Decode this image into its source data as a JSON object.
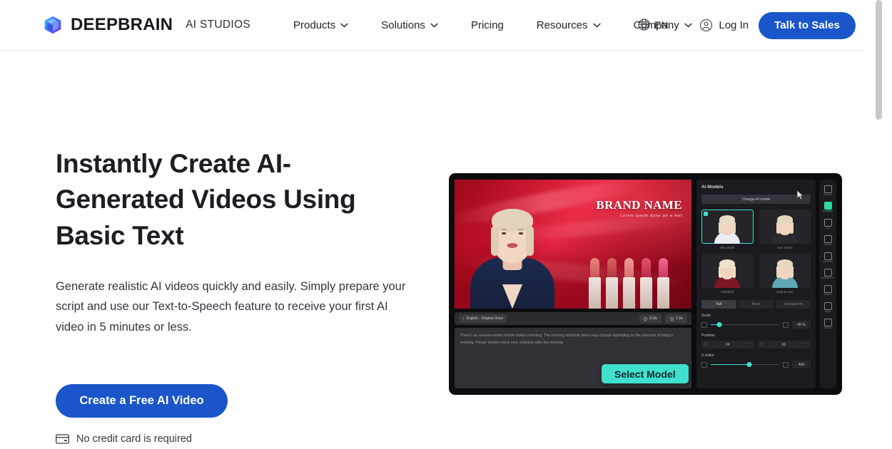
{
  "header": {
    "brand_name": "DEEPBRAIN",
    "brand_sub": "AI STUDIOS",
    "logo_icon": "cube-logo-icon",
    "nav": [
      {
        "label": "Products",
        "has_chevron": true,
        "icon": "chevron-down-icon"
      },
      {
        "label": "Solutions",
        "has_chevron": true,
        "icon": "chevron-down-icon"
      },
      {
        "label": "Pricing",
        "has_chevron": false,
        "icon": ""
      },
      {
        "label": "Resources",
        "has_chevron": true,
        "icon": "chevron-down-icon"
      },
      {
        "label": "Company",
        "has_chevron": true,
        "icon": "chevron-down-icon"
      }
    ],
    "language": {
      "label": "EN",
      "icon": "globe-icon"
    },
    "login": {
      "label": "Log In",
      "icon": "user-circle-icon"
    },
    "cta": {
      "label": "Talk to Sales",
      "color": "#1a56c9"
    }
  },
  "hero": {
    "headline": "Instantly Create AI-Generated Videos Using Basic Text",
    "subhead": "Generate realistic AI videos quickly and easily. Simply prepare your script and use our Text-to-Speech feature to receive your first AI video in 5 minutes or less.",
    "cta_label": "Create a Free AI Video",
    "cta_color": "#1a56c9",
    "note": "No credit card is required",
    "note_icon": "credit-card-icon"
  },
  "mock": {
    "stage": {
      "brand_name": "BRAND NAME",
      "brand_tagline": "Lorem ipsum dolor sit a met",
      "background_color": "#c2102a"
    },
    "script_bar": {
      "language_pill": "English - Original Voice",
      "language_icon": "voice-icon",
      "time_badges": [
        {
          "label": "0.3s",
          "icon": "clock-icon"
        },
        {
          "label": "1.0s",
          "icon": "clock-icon"
        }
      ]
    },
    "script_text": "There's an announcement before today's meeting. The morning schedule times may change depending on the outcome of today's meeting. Please double-check your schedule after the meeting.",
    "panel": {
      "title": "AI Models",
      "change_button": "Change AI model",
      "models": [
        {
          "name": "Mia Smith",
          "selected": true,
          "body": "#e9eef5",
          "hair": "#e8dcc6"
        },
        {
          "name": "Ann Jones",
          "selected": false,
          "body": "#2a2a31",
          "hair": "#e3d6bd"
        },
        {
          "name": "Rosaline",
          "selected": false,
          "body": "#7e1626",
          "hair": "#efe3cd"
        },
        {
          "name": "Sophia Kim",
          "selected": false,
          "body": "#5fa8b3",
          "hair": "#e6d9c0"
        }
      ],
      "tabs": [
        {
          "label": "Full",
          "active": true
        },
        {
          "label": "Body",
          "active": false
        },
        {
          "label": "Transparent",
          "active": false
        }
      ],
      "controls": {
        "scale": {
          "label": "Scale",
          "value": "40 %",
          "fill_pct": 12
        },
        "position": {
          "label": "Position",
          "x_label": "X",
          "x_value": "24",
          "y_label": "Y",
          "y_value": "61"
        },
        "z_index": {
          "label": "Z index",
          "value": "404",
          "fill_pct": 56
        }
      },
      "accent_color": "#3fe0cd"
    },
    "toolbar": [
      {
        "label": "Template",
        "icon": "template-icon",
        "active": false
      },
      {
        "label": "AI Model",
        "icon": "ai-model-icon",
        "active": true
      },
      {
        "label": "Text",
        "icon": "text-icon",
        "active": false
      },
      {
        "label": "Subtitle",
        "icon": "subtitle-icon",
        "active": false
      },
      {
        "label": "My Asset",
        "icon": "my-asset-icon",
        "active": false
      },
      {
        "label": "Background",
        "icon": "background-icon",
        "active": false
      },
      {
        "label": "Shapes",
        "icon": "shapes-icon",
        "active": false
      },
      {
        "label": "Audio",
        "icon": "audio-icon",
        "active": false
      },
      {
        "label": "Effects",
        "icon": "effects-icon",
        "active": false
      }
    ],
    "select_model_button": {
      "label": "Select Model",
      "color": "#3fe0cd"
    },
    "cursor_icon": "mouse-pointer-icon"
  }
}
